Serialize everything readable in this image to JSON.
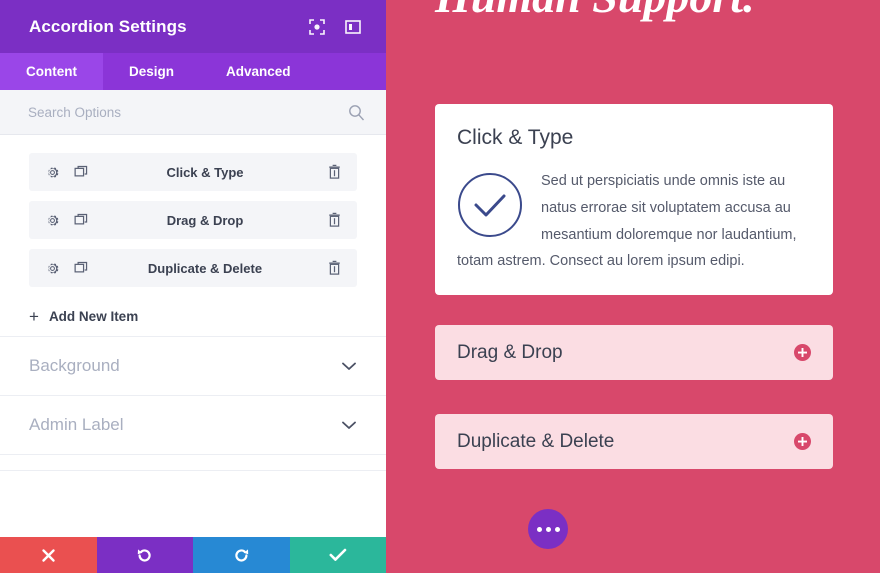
{
  "settings_panel": {
    "header": {
      "title": "Accordion Settings",
      "icons": [
        {
          "name": "focus-target-icon"
        },
        {
          "name": "panel-layout-icon"
        }
      ]
    },
    "tabs": [
      {
        "label": "Content",
        "active": true
      },
      {
        "label": "Design",
        "active": false
      },
      {
        "label": "Advanced",
        "active": false
      }
    ],
    "search": {
      "placeholder": "Search Options",
      "value": "",
      "icon": "search-icon"
    },
    "accordion_items": [
      {
        "label": "Click & Type",
        "settings_icon": "gear-icon",
        "duplicate_icon": "duplicate-icon",
        "delete_icon": "trash-icon"
      },
      {
        "label": "Drag & Drop",
        "settings_icon": "gear-icon",
        "duplicate_icon": "duplicate-icon",
        "delete_icon": "trash-icon"
      },
      {
        "label": "Duplicate & Delete",
        "settings_icon": "gear-icon",
        "duplicate_icon": "duplicate-icon",
        "delete_icon": "trash-icon"
      }
    ],
    "add_new_item": {
      "label": "Add New Item",
      "plus": "+"
    },
    "sections": [
      {
        "label": "Background",
        "chevron": "chevron-down-icon"
      },
      {
        "label": "Admin Label",
        "chevron": "chevron-down-icon"
      }
    ],
    "actions": [
      {
        "name": "close-button",
        "icon": "close-icon",
        "color": "#ea5050"
      },
      {
        "name": "undo-button",
        "icon": "undo-icon",
        "color": "#7b2fc4"
      },
      {
        "name": "redo-button",
        "icon": "redo-icon",
        "color": "#2789d4"
      },
      {
        "name": "save-button",
        "icon": "check-icon",
        "color": "#2bb79b"
      }
    ],
    "colors": {
      "header_purple": "#7b2fc4",
      "tabbar_purple": "#8b35d8",
      "tab_active_purple": "#9a46e8",
      "item_grey": "#f4f5f8"
    }
  },
  "preview": {
    "hero_title": "Human Support.",
    "background_color": "#d8486b",
    "open_item": {
      "title": "Click & Type",
      "icon": "check-circle-icon",
      "icon_color": "#3b4a8c",
      "body": "Sed ut perspiciatis unde omnis iste au natus errorae sit voluptatem accusa au mesantium doloremque nor laudantium, totam astrem. Consect au lorem ipsum edipi."
    },
    "closed_items": [
      {
        "label": "Drag & Drop",
        "toggle_icon": "plus-circle-icon"
      },
      {
        "label": "Duplicate & Delete",
        "toggle_icon": "plus-circle-icon"
      }
    ],
    "fab": {
      "name": "more-options-fab",
      "icon": "ellipsis-icon",
      "color": "#7b2fc4"
    }
  }
}
